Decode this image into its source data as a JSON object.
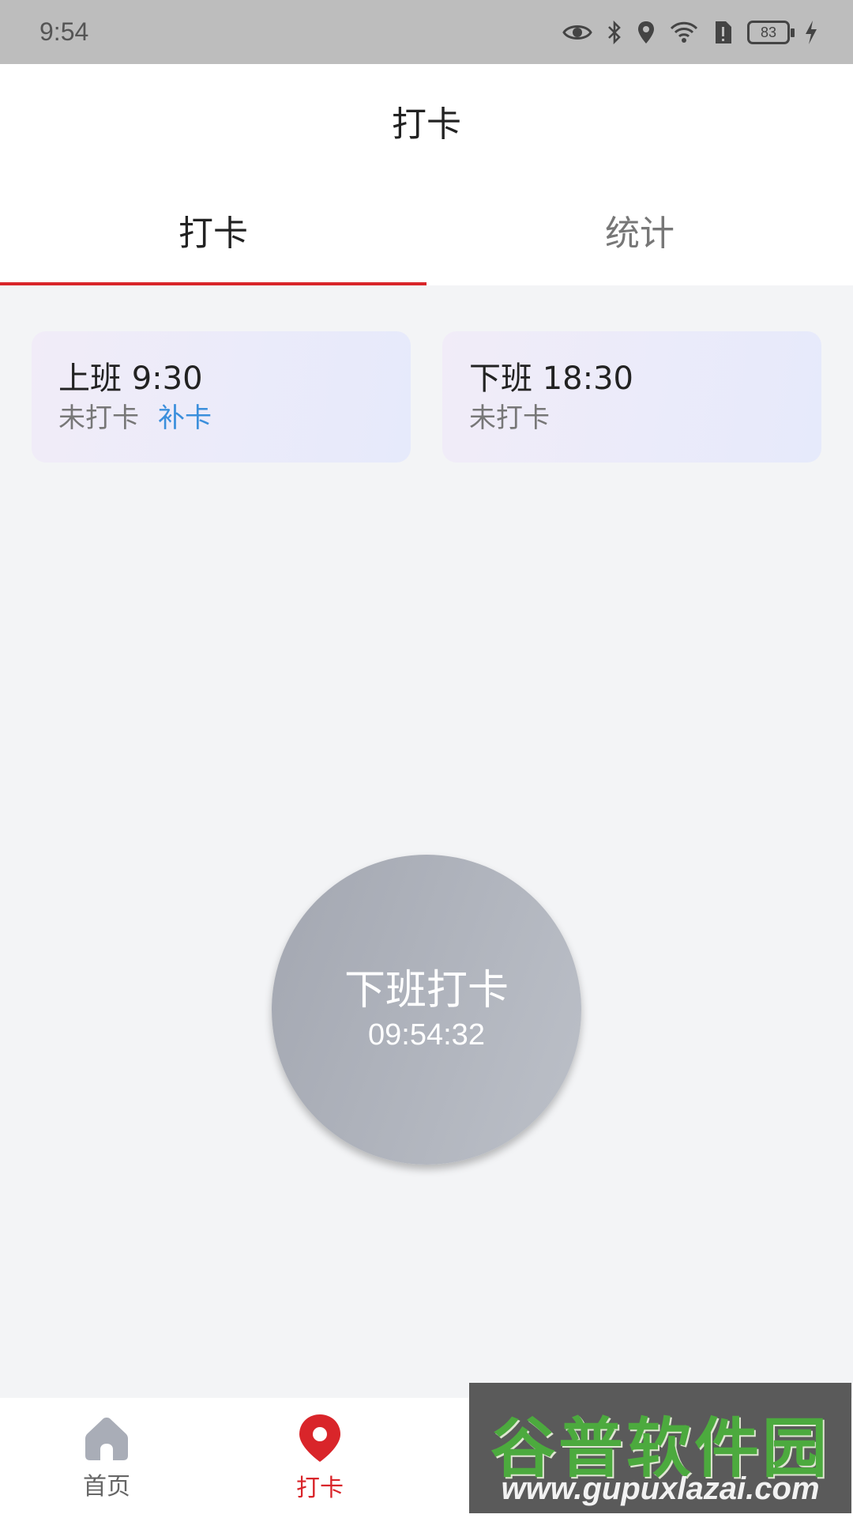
{
  "status_bar": {
    "time": "9:54",
    "battery": "83"
  },
  "header": {
    "title": "打卡"
  },
  "tabs": [
    {
      "label": "打卡",
      "active": true
    },
    {
      "label": "统计",
      "active": false
    }
  ],
  "shifts": [
    {
      "title": "上班 9:30",
      "status": "未打卡",
      "action": "补卡"
    },
    {
      "title": "下班 18:30",
      "status": "未打卡"
    }
  ],
  "punch_button": {
    "label": "下班打卡",
    "time": "09:54:32"
  },
  "bottom_nav": [
    {
      "label": "首页",
      "icon": "home-icon",
      "active": false
    },
    {
      "label": "打卡",
      "icon": "location-pin-icon",
      "active": true
    }
  ],
  "watermark": {
    "text": "谷普软件园",
    "url": "www.gupuxlazai.com"
  },
  "colors": {
    "accent": "#d9252a",
    "link": "#3b8fdc",
    "background": "#f3f4f6"
  }
}
